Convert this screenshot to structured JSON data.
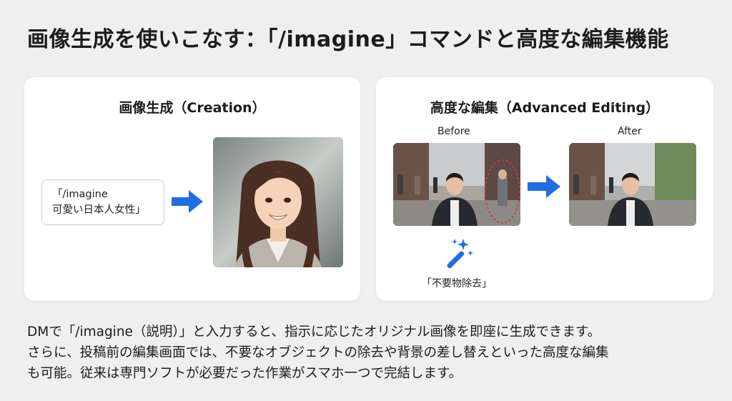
{
  "title": "画像生成を使いこなす：「/imagine」コマンドと高度な編集機能",
  "creation": {
    "title": "画像生成（Creation）",
    "prompt_line1": "「/imagine",
    "prompt_line2": "可愛い日本人女性」"
  },
  "editing": {
    "title": "高度な編集（Advanced Editing）",
    "before_label": "Before",
    "after_label": "After",
    "tool_label": "「不要物除去」"
  },
  "description": {
    "line1": "DMで「/imagine（説明）」と入力すると、指示に応じたオリジナル画像を即座に生成できます。",
    "line2": "さらに、投稿前の編集画面では、不要なオブジェクトの除去や背景の差し替えといった高度な編集",
    "line3": "も可能。従来は専門ソフトが必要だった作業がスマホ一つで完結します。"
  },
  "colors": {
    "accent_blue": "#1f6fe0",
    "card_bg": "#ffffff",
    "page_bg": "#efefef",
    "highlight_red": "#d23a3a"
  },
  "icons": {
    "arrow": "arrow-right-icon",
    "wand": "magic-wand-icon"
  }
}
